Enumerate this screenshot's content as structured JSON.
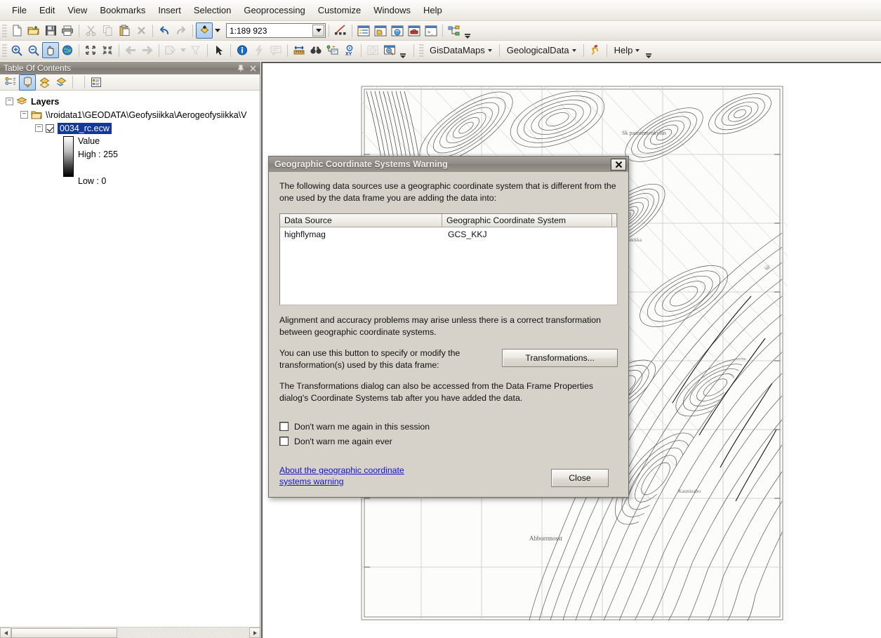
{
  "menu": {
    "items": [
      "File",
      "Edit",
      "View",
      "Bookmarks",
      "Insert",
      "Selection",
      "Geoprocessing",
      "Customize",
      "Windows",
      "Help"
    ]
  },
  "standard_toolbar": {
    "buttons": [
      {
        "name": "new-document-icon",
        "title": "New",
        "enabled": true
      },
      {
        "name": "open-folder-icon",
        "title": "Open",
        "enabled": true
      },
      {
        "name": "save-icon",
        "title": "Save",
        "enabled": true
      },
      {
        "name": "print-icon",
        "title": "Print",
        "enabled": true
      },
      {
        "name": "cut-scissors-icon",
        "title": "Cut",
        "enabled": false
      },
      {
        "name": "copy-icon",
        "title": "Copy",
        "enabled": false
      },
      {
        "name": "paste-icon",
        "title": "Paste",
        "enabled": true
      },
      {
        "name": "delete-x-icon",
        "title": "Delete",
        "enabled": false
      },
      {
        "name": "undo-arrow-icon",
        "title": "Undo",
        "enabled": true
      },
      {
        "name": "redo-arrow-icon",
        "title": "Redo",
        "enabled": false
      },
      {
        "name": "add-data-icon",
        "title": "Add Data",
        "enabled": true
      }
    ],
    "scale": {
      "value": "1:189 923",
      "placeholder": "1:189 923"
    },
    "right_buttons": [
      {
        "name": "editor-toolbar-icon",
        "title": "Editor Toolbar"
      },
      {
        "name": "table-of-contents-icon",
        "title": "Table Of Contents"
      },
      {
        "name": "catalog-window-icon",
        "title": "Catalog"
      },
      {
        "name": "search-window-icon",
        "title": "Search"
      },
      {
        "name": "arctoolbox-icon",
        "title": "ArcToolbox"
      },
      {
        "name": "python-window-icon",
        "title": "Python Window"
      },
      {
        "name": "model-builder-icon",
        "title": "ModelBuilder"
      }
    ]
  },
  "tools_toolbar": {
    "buttons": [
      {
        "name": "zoom-in-icon",
        "title": "Zoom In",
        "enabled": true
      },
      {
        "name": "zoom-out-icon",
        "title": "Zoom Out",
        "enabled": true
      },
      {
        "name": "pan-hand-icon",
        "title": "Pan",
        "enabled": true,
        "active": true
      },
      {
        "name": "full-extent-globe-icon",
        "title": "Full Extent",
        "enabled": true
      },
      {
        "name": "fixed-zoom-in-icon",
        "title": "Fixed Zoom In",
        "enabled": true
      },
      {
        "name": "fixed-zoom-out-icon",
        "title": "Fixed Zoom Out",
        "enabled": true
      },
      {
        "name": "back-extent-icon",
        "title": "Go Back To Previous Extent",
        "enabled": false
      },
      {
        "name": "forward-extent-icon",
        "title": "Go To Next Extent",
        "enabled": false
      },
      {
        "name": "select-features-icon",
        "title": "Select Features",
        "enabled": false
      },
      {
        "name": "clear-selection-icon",
        "title": "Clear Selected Features",
        "enabled": false
      },
      {
        "name": "select-elements-arrow-icon",
        "title": "Select Elements",
        "enabled": true
      },
      {
        "name": "identify-info-icon",
        "title": "Identify",
        "enabled": true
      },
      {
        "name": "hyperlink-lightning-icon",
        "title": "Hyperlink",
        "enabled": false
      },
      {
        "name": "html-popup-icon",
        "title": "HTML Popup",
        "enabled": false
      },
      {
        "name": "measure-ruler-icon",
        "title": "Measure",
        "enabled": true
      },
      {
        "name": "find-binoculars-icon",
        "title": "Find",
        "enabled": true
      },
      {
        "name": "find-route-icon",
        "title": "Find Route",
        "enabled": true
      },
      {
        "name": "go-to-xy-icon",
        "title": "Go To XY",
        "enabled": true
      },
      {
        "name": "time-slider-icon",
        "title": "Time Slider",
        "enabled": false
      },
      {
        "name": "create-viewer-window-icon",
        "title": "Create Viewer Window",
        "enabled": true
      }
    ],
    "menus": [
      {
        "name": "gisdatamaps-menu",
        "label": "GisDataMaps"
      },
      {
        "name": "geologicaldata-menu",
        "label": "GeologicalData"
      },
      {
        "name": "run-macro-icon",
        "label": ""
      },
      {
        "name": "help-menu",
        "label": "Help"
      }
    ]
  },
  "toc": {
    "title": "Table Of Contents",
    "pin_icon": "pin-icon",
    "close_icon": "close-icon",
    "tool_buttons": [
      {
        "name": "list-by-drawing-order-icon",
        "active": false
      },
      {
        "name": "list-by-source-icon",
        "active": true
      },
      {
        "name": "list-by-visibility-icon",
        "active": false
      },
      {
        "name": "list-by-selection-icon",
        "active": false
      },
      {
        "name": "options-icon",
        "active": false
      }
    ],
    "tree": {
      "root_label": "Layers",
      "folder_label": "\\\\roidata1\\GEODATA\\Geofysiikka\\Aerogeofysiikka\\V",
      "layer_label": "0034_rc.ecw",
      "layer_checked": true,
      "legend_title": "Value",
      "legend_high": "High : 255",
      "legend_low": "Low : 0"
    }
  },
  "dialog": {
    "title": "Geographic Coordinate Systems Warning",
    "close_label": "✕",
    "intro": "The following data sources use a geographic coordinate system that is different from the one used by the data frame you are adding the data into:",
    "table": {
      "columns": [
        "Data Source",
        "Geographic Coordinate System",
        ""
      ],
      "rows": [
        [
          "highflymag",
          "GCS_KKJ",
          ""
        ]
      ]
    },
    "alignment_text": "Alignment and accuracy problems may arise unless there is a correct transformation between geographic coordinate systems.",
    "button_help_text": "You can use this button to specify or modify the transformation(s) used by this data frame:",
    "transformations_button": "Transformations...",
    "dialog_note": "The Transformations dialog can also be accessed from the Data Frame Properties dialog's Coordinate Systems tab after you have added the data.",
    "checkbox_session": "Don't warn me again in this session",
    "checkbox_ever": "Don't warn me again ever",
    "checkbox_session_checked": false,
    "checkbox_ever_checked": false,
    "link_line1": "About the geographic coordinate ",
    "link_line2": "systems warning",
    "close_button": "Close"
  },
  "map": {
    "labels": [
      "Sk paaniemenkylän",
      "Abborrmosst",
      "F 7, 5"
    ]
  },
  "colors": {
    "dialog_face": "#d6d2ca",
    "title_bar": "#8b8780",
    "selection_blue": "#11399c",
    "link_blue": "#1414c8",
    "panel_border": "#9a968e"
  }
}
